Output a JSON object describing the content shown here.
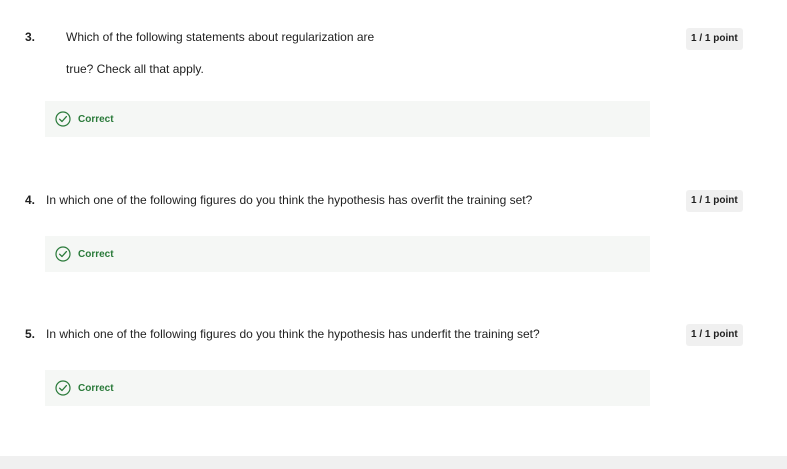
{
  "questions": [
    {
      "number": "3.",
      "text_line1": "Which of the following statements about regularization are",
      "text_line2": "true?  Check all that apply.",
      "score": "1 / 1 point",
      "feedback": "Correct"
    },
    {
      "number": "4.",
      "text_line1": "In which one of the following figures do you think the hypothesis has overfit the training set?",
      "score": "1 / 1 point",
      "feedback": "Correct"
    },
    {
      "number": "5.",
      "text_line1": "In which one of the following figures do you think the hypothesis has underfit the training set?",
      "score": "1 / 1 point",
      "feedback": "Correct"
    }
  ],
  "colors": {
    "correct": "#2a7a3a",
    "feedback_bg": "#f5f7f5",
    "badge_bg": "#f0f0f0"
  }
}
